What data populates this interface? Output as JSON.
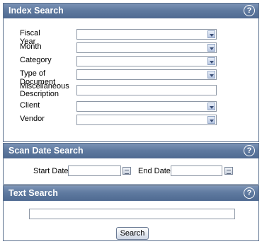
{
  "index_search": {
    "title": "Index Search",
    "help": "?",
    "fields": [
      {
        "label": "Fiscal Year",
        "type": "select"
      },
      {
        "label": "Month",
        "type": "select"
      },
      {
        "label": "Category",
        "type": "select"
      },
      {
        "label": "Type of Document",
        "type": "select"
      },
      {
        "label": "Miscellaneous Description",
        "type": "text"
      },
      {
        "label": "Client",
        "type": "select"
      },
      {
        "label": "Vendor",
        "type": "select"
      }
    ]
  },
  "scan_date_search": {
    "title": "Scan Date Search",
    "help": "?",
    "start_label": "Start Date",
    "end_label": "End Date"
  },
  "text_search": {
    "title": "Text Search",
    "help": "?",
    "button": "Search"
  }
}
